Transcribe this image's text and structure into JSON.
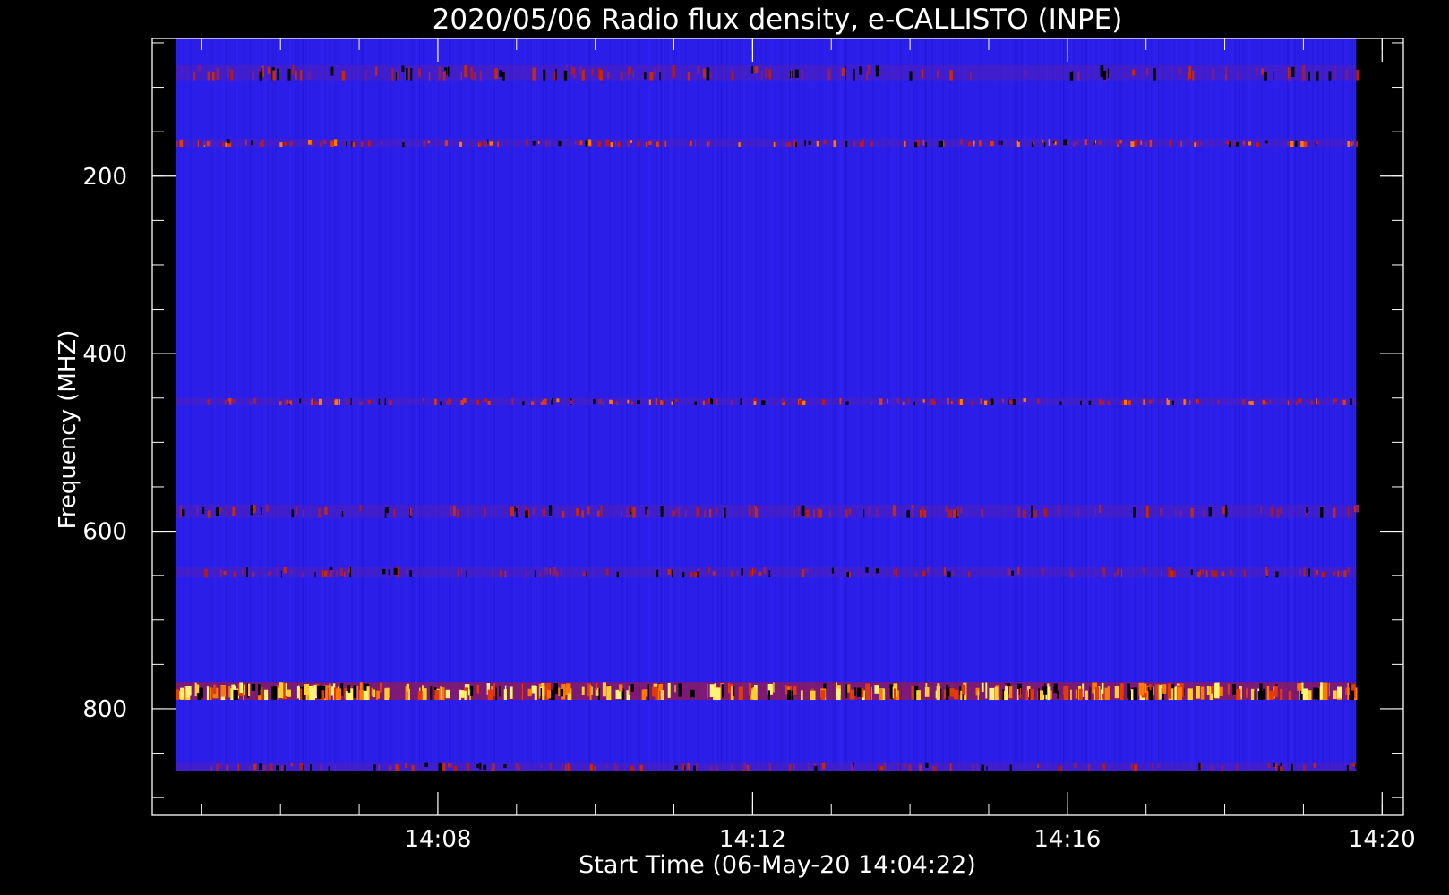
{
  "chart_data": {
    "type": "heatmap",
    "title": "2020/05/06  Radio flux density, e-CALLISTO (INPE)",
    "xlabel": "Start Time (06-May-20 14:04:22)",
    "ylabel": "Frequency (MHZ)",
    "x_unit": "minutes since 14:04:22",
    "xlim": [
      0,
      15.9
    ],
    "ylim": [
      45,
      920
    ],
    "data_x_range": [
      0.3,
      15.3
    ],
    "data_y_range": [
      45,
      870
    ],
    "x_ticks": [
      {
        "label": "14:08",
        "value": 3.63
      },
      {
        "label": "14:12",
        "value": 7.63
      },
      {
        "label": "14:16",
        "value": 11.63
      },
      {
        "label": "14:20",
        "value": 15.63
      }
    ],
    "y_ticks": [
      {
        "label": "200",
        "value": 200
      },
      {
        "label": "400",
        "value": 400
      },
      {
        "label": "600",
        "value": 600
      },
      {
        "label": "800",
        "value": 800
      }
    ],
    "background_color": "#2a1ee8",
    "emission_bands": [
      {
        "freq_low": 75,
        "freq_high": 92,
        "intensity": "moderate"
      },
      {
        "freq_low": 158,
        "freq_high": 167,
        "intensity": "strong"
      },
      {
        "freq_low": 450,
        "freq_high": 458,
        "intensity": "strong"
      },
      {
        "freq_low": 570,
        "freq_high": 585,
        "intensity": "moderate"
      },
      {
        "freq_low": 640,
        "freq_high": 652,
        "intensity": "moderate"
      },
      {
        "freq_low": 770,
        "freq_high": 790,
        "intensity": "very strong"
      },
      {
        "freq_low": 860,
        "freq_high": 870,
        "intensity": "moderate"
      }
    ]
  }
}
